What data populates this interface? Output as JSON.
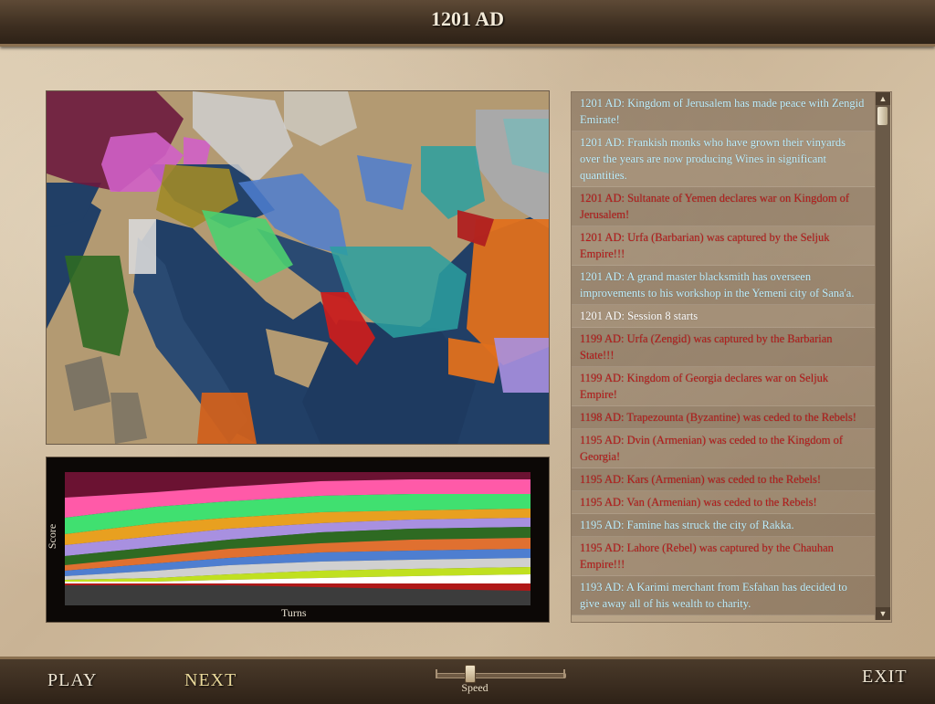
{
  "header": {
    "title": "1201 AD"
  },
  "footer": {
    "play_label": "PLAY",
    "next_label": "NEXT",
    "exit_label": "EXIT",
    "speed_label": "Speed"
  },
  "graph": {
    "ylabel": "Score",
    "xlabel": "Turns"
  },
  "log": [
    {
      "text": "1201 AD: Kingdom of Jerusalem has made peace with Zengid Emirate!",
      "color": "cyan"
    },
    {
      "text": "1201 AD: Frankish monks who have grown their vinyards over the years are now producing Wines in significant quantities.",
      "color": "cyan"
    },
    {
      "text": "1201 AD: Sultanate of Yemen declares war on Kingdom of Jerusalem!",
      "color": "red"
    },
    {
      "text": "1201 AD: Urfa (Barbarian) was captured by the Seljuk Empire!!!",
      "color": "red"
    },
    {
      "text": "1201 AD: A grand master blacksmith has overseen improvements to his workshop in the Yemeni city of Sana'a.",
      "color": "cyan"
    },
    {
      "text": "1201 AD: Session 8 starts",
      "color": "white"
    },
    {
      "text": "1199 AD: Urfa (Zengid) was captured by the Barbarian State!!!",
      "color": "red"
    },
    {
      "text": "1199 AD: Kingdom of Georgia declares war on Seljuk Empire!",
      "color": "red"
    },
    {
      "text": "1198 AD: Trapezounta (Byzantine) was ceded to the Rebels!",
      "color": "red"
    },
    {
      "text": "1195 AD: Dvin (Armenian) was ceded to the Kingdom of Georgia!",
      "color": "red"
    },
    {
      "text": "1195 AD: Kars (Armenian) was ceded to the Rebels!",
      "color": "red"
    },
    {
      "text": "1195 AD: Van (Armenian) was ceded to the Rebels!",
      "color": "red"
    },
    {
      "text": "1195 AD: Famine has struck the city of Rakka.",
      "color": "cyan"
    },
    {
      "text": "1195 AD: Lahore (Rebel) was captured by the Chauhan Empire!!!",
      "color": "red"
    },
    {
      "text": "1193 AD: A Karimi merchant from Esfahan has decided to give away all of his wealth to charity.",
      "color": "cyan"
    }
  ],
  "colors": {
    "header_bg": "#3d2e20",
    "parchment": "#cbb79c",
    "log_cyan": "#bff0ff",
    "log_red": "#b81a1a"
  }
}
